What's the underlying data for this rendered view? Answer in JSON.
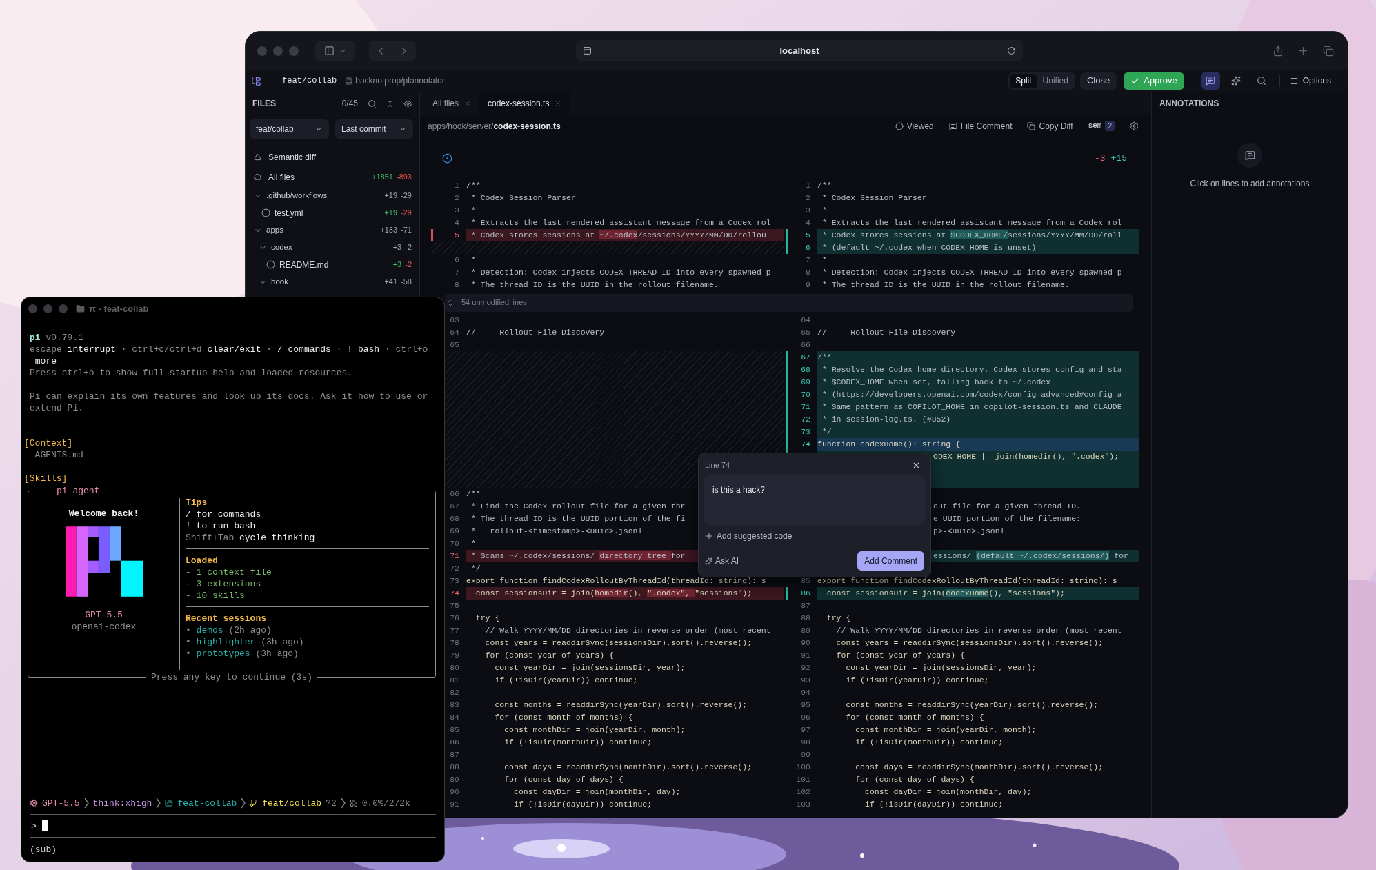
{
  "browser": {
    "url": "localhost"
  },
  "toolbar": {
    "branch": "feat/collab",
    "repo": "backnotprop/plannotator",
    "view_modes": [
      {
        "label": "Split",
        "selected": true
      },
      {
        "label": "Unified",
        "selected": false
      }
    ],
    "close": "Close",
    "approve": "Approve",
    "tools": [
      {
        "kind": "comments",
        "selected": true
      },
      {
        "kind": "ai",
        "selected": false
      },
      {
        "kind": "search",
        "selected": false
      }
    ],
    "options": "Options"
  },
  "sidebar": {
    "title": "FILES",
    "count": "0/45",
    "branch_select": "feat/collab",
    "range_select": "Last commit",
    "views": [
      {
        "kind": "semantic",
        "label": "Semantic diff"
      },
      {
        "kind": "all",
        "label": "All files",
        "added": "+1851",
        "removed": "-893"
      }
    ],
    "tree": [
      {
        "kind": "folder",
        "name": ".github/workflows",
        "expanded": true,
        "added": "+19",
        "removed": "-29",
        "children": [
          {
            "kind": "file",
            "name": "test.yml",
            "viewed": false,
            "added": "+19",
            "removed": "-29"
          }
        ]
      },
      {
        "kind": "folder",
        "name": "apps",
        "expanded": true,
        "added": "+133",
        "removed": "-71",
        "children": [
          {
            "kind": "folder",
            "name": "codex",
            "expanded": true,
            "added": "+3",
            "removed": "-2",
            "children": [
              {
                "kind": "file",
                "name": "README.md",
                "viewed": false,
                "added": "+3",
                "removed": "-2"
              }
            ]
          },
          {
            "kind": "folder",
            "name": "hook",
            "expanded": true,
            "added": "+41",
            "removed": "-58"
          }
        ]
      }
    ]
  },
  "tabs": [
    {
      "label": "All files",
      "selected": false
    },
    {
      "label": "codex-session.ts",
      "selected": true
    }
  ],
  "path": "apps/hook/server/**codex-session.ts**",
  "file_actions": [
    {
      "kind": "viewed",
      "label": "Viewed"
    },
    {
      "kind": "comment",
      "label": "File Comment"
    },
    {
      "kind": "copy",
      "label": "Copy Diff"
    },
    {
      "kind": "sem",
      "label": "sem",
      "badge": "2"
    },
    {
      "kind": "settings"
    }
  ],
  "diff": {
    "removed": "-3",
    "added": "+15",
    "collapsed": "54 unmodified lines",
    "top_rows": [
      {
        "left": {
          "num": "1",
          "kind": "comment",
          "changed": false,
          "text": "/**"
        },
        "right": {
          "num": "1",
          "kind": "comment",
          "changed": false,
          "text": "/**"
        }
      },
      {
        "left": {
          "num": "2",
          "kind": "comment",
          "changed": false,
          "text": " * Codex Session Parser"
        },
        "right": {
          "num": "2",
          "kind": "comment",
          "changed": false,
          "text": " * Codex Session Parser"
        }
      },
      {
        "left": {
          "num": "3",
          "kind": "comment",
          "changed": false,
          "text": " *"
        },
        "right": {
          "num": "3",
          "kind": "comment",
          "changed": false,
          "text": " *"
        }
      },
      {
        "left": {
          "num": "4",
          "kind": "comment",
          "changed": false,
          "text": " * Extracts the last rendered assistant message from a Codex rol"
        },
        "right": {
          "num": "4",
          "kind": "comment",
          "changed": false,
          "text": " * Extracts the last rendered assistant message from a Codex rol"
        }
      },
      {
        "left": {
          "num": "5",
          "kind": "comment",
          "changed": true,
          "segs": [
            {
              "text": " * Codex stores sessions at ",
              "hl": false
            },
            {
              "text": "~/.codex",
              "hl": true
            },
            {
              "text": "/sessions/YYYY/MM/DD/rollou",
              "hl": false
            }
          ]
        },
        "right": {
          "num": "5",
          "kind": "comment",
          "changed": true,
          "segs": [
            {
              "text": " * Codex stores sessions at ",
              "hl": false
            },
            {
              "text": "$CODEX_HOME/",
              "hl": true
            },
            {
              "text": "sessions/YYYY/MM/DD/roll",
              "hl": false
            }
          ]
        }
      },
      {
        "left": {
          "kind": "filler"
        },
        "right": {
          "num": "6",
          "kind": "comment",
          "changed": true,
          "text": " * (default ~/.codex when CODEX_HOME is unset)"
        }
      },
      {
        "left": {
          "num": "6",
          "kind": "comment",
          "changed": false,
          "text": " *"
        },
        "right": {
          "num": "7",
          "kind": "comment",
          "changed": false,
          "text": " *"
        }
      },
      {
        "left": {
          "num": "7",
          "kind": "comment",
          "changed": false,
          "text": " * Detection: Codex injects CODEX_THREAD_ID into every spawned p"
        },
        "right": {
          "num": "8",
          "kind": "comment",
          "changed": false,
          "text": " * Detection: Codex injects CODEX_THREAD_ID into every spawned p"
        }
      },
      {
        "left": {
          "num": "8",
          "kind": "comment",
          "changed": false,
          "text": " * The thread ID is the UUID in the rollout filename."
        },
        "right": {
          "num": "9",
          "kind": "comment",
          "changed": false,
          "text": " * The thread ID is the UUID in the rollout filename."
        }
      }
    ],
    "rows": [
      {
        "left": {
          "num": "63",
          "kind": "blank",
          "changed": false
        },
        "right": {
          "num": "64",
          "kind": "blank",
          "changed": false
        }
      },
      {
        "left": {
          "num": "64",
          "kind": "comment",
          "changed": false,
          "text": "// --- Rollout File Discovery ---"
        },
        "right": {
          "num": "65",
          "kind": "comment",
          "changed": false,
          "text": "// --- Rollout File Discovery ---"
        }
      },
      {
        "left": {
          "num": "65",
          "kind": "blank",
          "changed": false
        },
        "right": {
          "num": "66",
          "kind": "blank",
          "changed": false
        }
      },
      {
        "left": {
          "kind": "filler"
        },
        "right": {
          "num": "67",
          "kind": "comment",
          "changed": true,
          "text": "/**"
        }
      },
      {
        "left": {
          "kind": "filler"
        },
        "right": {
          "num": "68",
          "kind": "comment",
          "changed": true,
          "text": " * Resolve the Codex home directory. Codex stores config and sta"
        }
      },
      {
        "left": {
          "kind": "filler"
        },
        "right": {
          "num": "69",
          "kind": "comment",
          "changed": true,
          "text": " * $CODEX_HOME when set, falling back to ~/.codex"
        }
      },
      {
        "left": {
          "kind": "filler"
        },
        "right": {
          "num": "70",
          "kind": "comment",
          "changed": true,
          "text": " * (https://developers.openai.com/codex/config-advanced#config-a"
        }
      },
      {
        "left": {
          "kind": "filler"
        },
        "right": {
          "num": "71",
          "kind": "comment",
          "changed": true,
          "text": " * Same pattern as COPILOT_HOME in copilot-session.ts and CLAUDE"
        }
      },
      {
        "left": {
          "kind": "filler"
        },
        "right": {
          "num": "72",
          "kind": "comment",
          "changed": true,
          "text": " * in session-log.ts. (#852)"
        }
      },
      {
        "left": {
          "kind": "filler"
        },
        "right": {
          "num": "73",
          "kind": "comment",
          "changed": true,
          "text": " */"
        }
      },
      {
        "left": {
          "kind": "filler"
        },
        "right": {
          "num": "74",
          "kind": "code",
          "changed": true,
          "selected": true,
          "text": "function codexHome(): string {"
        }
      },
      {
        "left": {
          "kind": "filler"
        },
        "right": {
          "kind": "code",
          "changed": true,
          "covered": true,
          "text": "ODEX_HOME || join(homedir(), \".codex\");"
        }
      },
      {
        "left": {
          "kind": "filler"
        },
        "right": {
          "kind": "blank",
          "changed": true
        }
      },
      {
        "left": {
          "kind": "filler"
        },
        "right": {
          "kind": "blank",
          "changed": true
        }
      },
      {
        "left": {
          "num": "66",
          "kind": "comment",
          "changed": false,
          "text": "/**"
        },
        "right": {
          "kind": "blank",
          "changed": false
        }
      },
      {
        "left": {
          "num": "67",
          "kind": "comment",
          "changed": false,
          "text": " * Find the Codex rollout file for a given thr"
        },
        "right": {
          "kind": "comment",
          "changed": false,
          "covered": true,
          "text": "out file for a given thread ID."
        }
      },
      {
        "left": {
          "num": "68",
          "kind": "comment",
          "changed": false,
          "text": " * The thread ID is the UUID portion of the fi"
        },
        "right": {
          "kind": "comment",
          "changed": false,
          "covered": true,
          "text": "e UUID portion of the filename:"
        }
      },
      {
        "left": {
          "num": "69",
          "kind": "comment",
          "changed": false,
          "text": " *   rollout-<timestamp>-<uuid>.jsonl"
        },
        "right": {
          "kind": "comment",
          "changed": false,
          "covered": true,
          "text": "p>-<uuid>.jsonl"
        }
      },
      {
        "left": {
          "num": "70",
          "kind": "comment",
          "changed": false,
          "text": " *"
        },
        "right": {
          "kind": "blank",
          "changed": false
        }
      },
      {
        "left": {
          "num": "71",
          "kind": "comment",
          "changed": true,
          "segs": [
            {
              "text": " * Scans ~/.codex/sessions/ ",
              "hl": false
            },
            {
              "text": "directory tree ",
              "hl": true
            },
            {
              "text": "for",
              "hl": false
            }
          ]
        },
        "right": {
          "kind": "comment",
          "changed": true,
          "covered": true,
          "segs": [
            {
              "text": "essions/ ",
              "hl": false
            },
            {
              "text": "(default ~/.codex/sessions/)",
              "hl": true
            },
            {
              "text": " for",
              "hl": false
            }
          ]
        }
      },
      {
        "left": {
          "num": "72",
          "kind": "comment",
          "changed": false,
          "text": " */"
        },
        "right": {
          "kind": "blank",
          "changed": false
        }
      },
      {
        "left": {
          "num": "73",
          "kind": "code",
          "changed": false,
          "text": "export function findCodexRolloutByThreadId(threadId: string): s"
        },
        "right": {
          "num": "85",
          "kind": "code",
          "changed": false,
          "text": "export function findCodexRolloutByThreadId(threadId: string): s"
        }
      },
      {
        "left": {
          "num": "74",
          "kind": "code",
          "changed": true,
          "segs": [
            {
              "text": "  const sessionsDir = join(",
              "hl": false
            },
            {
              "text": "homedir",
              "hl": true
            },
            {
              "text": "(), ",
              "hl": false
            },
            {
              "text": "\".codex\", ",
              "hl": true
            },
            {
              "text": "\"sessions\");",
              "hl": false
            }
          ]
        },
        "right": {
          "num": "86",
          "kind": "code",
          "changed": true,
          "segs": [
            {
              "text": "  const sessionsDir = join(",
              "hl": false
            },
            {
              "text": "codexHome",
              "hl": true
            },
            {
              "text": "(), \"sessions\");",
              "hl": false
            }
          ]
        }
      },
      {
        "left": {
          "num": "75",
          "kind": "blank",
          "changed": false
        },
        "right": {
          "num": "87",
          "kind": "blank",
          "changed": false
        }
      },
      {
        "left": {
          "num": "76",
          "kind": "code",
          "changed": false,
          "text": "  try {"
        },
        "right": {
          "num": "88",
          "kind": "code",
          "changed": false,
          "text": "  try {"
        }
      },
      {
        "left": {
          "num": "77",
          "kind": "comment",
          "changed": false,
          "text": "    // Walk YYYY/MM/DD directories in reverse order (most recent"
        },
        "right": {
          "num": "89",
          "kind": "comment",
          "changed": false,
          "text": "    // Walk YYYY/MM/DD directories in reverse order (most recent"
        }
      },
      {
        "left": {
          "num": "78",
          "kind": "code",
          "changed": false,
          "text": "    const years = readdirSync(sessionsDir).sort().reverse();"
        },
        "right": {
          "num": "90",
          "kind": "code",
          "changed": false,
          "text": "    const years = readdirSync(sessionsDir).sort().reverse();"
        }
      },
      {
        "left": {
          "num": "79",
          "kind": "code",
          "changed": false,
          "text": "    for (const year of years) {"
        },
        "right": {
          "num": "91",
          "kind": "code",
          "changed": false,
          "text": "    for (const year of years) {"
        }
      },
      {
        "left": {
          "num": "80",
          "kind": "code",
          "changed": false,
          "text": "      const yearDir = join(sessionsDir, year);"
        },
        "right": {
          "num": "92",
          "kind": "code",
          "changed": false,
          "text": "      const yearDir = join(sessionsDir, year);"
        }
      },
      {
        "left": {
          "num": "81",
          "kind": "code",
          "changed": false,
          "text": "      if (!isDir(yearDir)) continue;"
        },
        "right": {
          "num": "93",
          "kind": "code",
          "changed": false,
          "text": "      if (!isDir(yearDir)) continue;"
        }
      },
      {
        "left": {
          "num": "82",
          "kind": "blank",
          "changed": false
        },
        "right": {
          "num": "94",
          "kind": "blank",
          "changed": false
        }
      },
      {
        "left": {
          "num": "83",
          "kind": "code",
          "changed": false,
          "text": "      const months = readdirSync(yearDir).sort().reverse();"
        },
        "right": {
          "num": "95",
          "kind": "code",
          "changed": false,
          "text": "      const months = readdirSync(yearDir).sort().reverse();"
        }
      },
      {
        "left": {
          "num": "84",
          "kind": "code",
          "changed": false,
          "text": "      for (const month of months) {"
        },
        "right": {
          "num": "96",
          "kind": "code",
          "changed": false,
          "text": "      for (const month of months) {"
        }
      },
      {
        "left": {
          "num": "85",
          "kind": "code",
          "changed": false,
          "text": "        const monthDir = join(yearDir, month);"
        },
        "right": {
          "num": "97",
          "kind": "code",
          "changed": false,
          "text": "        const monthDir = join(yearDir, month);"
        }
      },
      {
        "left": {
          "num": "86",
          "kind": "code",
          "changed": false,
          "text": "        if (!isDir(monthDir)) continue;"
        },
        "right": {
          "num": "98",
          "kind": "code",
          "changed": false,
          "text": "        if (!isDir(monthDir)) continue;"
        }
      },
      {
        "left": {
          "num": "87",
          "kind": "blank",
          "changed": false
        },
        "right": {
          "num": "99",
          "kind": "blank",
          "changed": false
        }
      },
      {
        "left": {
          "num": "88",
          "kind": "code",
          "changed": false,
          "text": "        const days = readdirSync(monthDir).sort().reverse();"
        },
        "right": {
          "num": "100",
          "kind": "code",
          "changed": false,
          "text": "        const days = readdirSync(monthDir).sort().reverse();"
        }
      },
      {
        "left": {
          "num": "89",
          "kind": "code",
          "changed": false,
          "text": "        for (const day of days) {"
        },
        "right": {
          "num": "101",
          "kind": "code",
          "changed": false,
          "text": "        for (const day of days) {"
        }
      },
      {
        "left": {
          "num": "90",
          "kind": "code",
          "changed": false,
          "text": "          const dayDir = join(monthDir, day);"
        },
        "right": {
          "num": "102",
          "kind": "code",
          "changed": false,
          "text": "          const dayDir = join(monthDir, day);"
        }
      },
      {
        "left": {
          "num": "91",
          "kind": "code",
          "changed": false,
          "text": "          if (!isDir(dayDir)) continue;"
        },
        "right": {
          "num": "103",
          "kind": "code",
          "changed": false,
          "text": "          if (!isDir(dayDir)) continue;"
        }
      }
    ]
  },
  "comment_popup": {
    "title": "Line 74",
    "value": "is this a hack?",
    "suggest": "Add suggested code",
    "ask": "Ask AI",
    "submit": "Add Comment"
  },
  "annotations": {
    "title": "ANNOTATIONS",
    "empty": "Click on lines to add annotations"
  },
  "terminal": {
    "title": "π - feat-collab",
    "intro": [
      [
        [
          {
            "text": "pi",
            "kind": "accent"
          },
          {
            "text": " v0.79.1",
            "kind": "dim"
          }
        ],
        [
          {
            "text": "escape",
            "kind": "dim"
          },
          {
            "text": " interrupt",
            "kind": "bright"
          },
          {
            "text": " · ctrl+c/ctrl+d",
            "kind": "dim"
          },
          {
            "text": " clear/exit",
            "kind": "bright"
          },
          {
            "text": " · ",
            "kind": "dim"
          },
          {
            "text": "/ commands",
            "kind": "bright"
          },
          {
            "text": " · ",
            "kind": "dim"
          },
          {
            "text": "! bash",
            "kind": "bright"
          },
          {
            "text": " · ctrl+o",
            "kind": "dim"
          }
        ],
        [
          {
            "text": " more",
            "kind": "bright"
          }
        ],
        [
          {
            "text": "Press ctrl+o to show full startup help and loaded resources.",
            "kind": "dim"
          }
        ]
      ],
      [
        [
          {
            "text": "Pi can explain its own features and look up its docs. Ask it how to use or",
            "kind": "dim"
          }
        ],
        [
          {
            "text": "extend Pi.",
            "kind": "dim"
          }
        ]
      ]
    ],
    "sections": [
      {
        "heading": "[Context]",
        "items": [
          "  AGENTS.md"
        ]
      },
      {
        "heading": "[Skills]"
      }
    ],
    "panel": {
      "title": "pi agent",
      "welcome": "Welcome back!",
      "model": "GPT-5.5",
      "provider": "openai-codex",
      "footer": "Press any key to continue (3s)",
      "sections": [
        {
          "heading": "Tips",
          "lines": [
            [
              {
                "text": "/ for commands",
                "kind": "bright"
              }
            ],
            [
              {
                "text": "! to run bash",
                "kind": "bright"
              }
            ],
            [
              {
                "text": "Shift+Tab",
                "kind": "dim"
              },
              {
                "text": " cycle thinking",
                "kind": "bright"
              }
            ]
          ]
        },
        {
          "heading": "Loaded",
          "lines": [
            [
              {
                "text": "- 1 context file",
                "kind": "green"
              }
            ],
            [
              {
                "text": "- 3 extensions",
                "kind": "green"
              }
            ],
            [
              {
                "text": "- 10 skills",
                "kind": "green"
              }
            ]
          ]
        },
        {
          "heading": "Recent sessions",
          "lines": [
            [
              {
                "text": "• ",
                "kind": "dim"
              },
              {
                "text": "demos",
                "kind": "teal"
              },
              {
                "text": " (2h ago)",
                "kind": "dim"
              }
            ],
            [
              {
                "text": "• ",
                "kind": "dim"
              },
              {
                "text": "highlighter",
                "kind": "teal"
              },
              {
                "text": " (3h ago)",
                "kind": "dim"
              }
            ],
            [
              {
                "text": "• ",
                "kind": "dim"
              },
              {
                "text": "prototypes",
                "kind": "teal"
              },
              {
                "text": " (3h ago)",
                "kind": "dim"
              }
            ]
          ]
        }
      ]
    },
    "status": [
      {
        "kind": "model",
        "text": "GPT-5.5"
      },
      {
        "kind": "thinking",
        "text": "think:xhigh"
      },
      {
        "kind": "folder",
        "text": "feat-collab"
      },
      {
        "kind": "branch",
        "text": "feat/collab",
        "extra": "?2"
      },
      {
        "kind": "context",
        "text": "0.0%/272k"
      }
    ],
    "prompt": ">",
    "footer": "(sub)"
  }
}
